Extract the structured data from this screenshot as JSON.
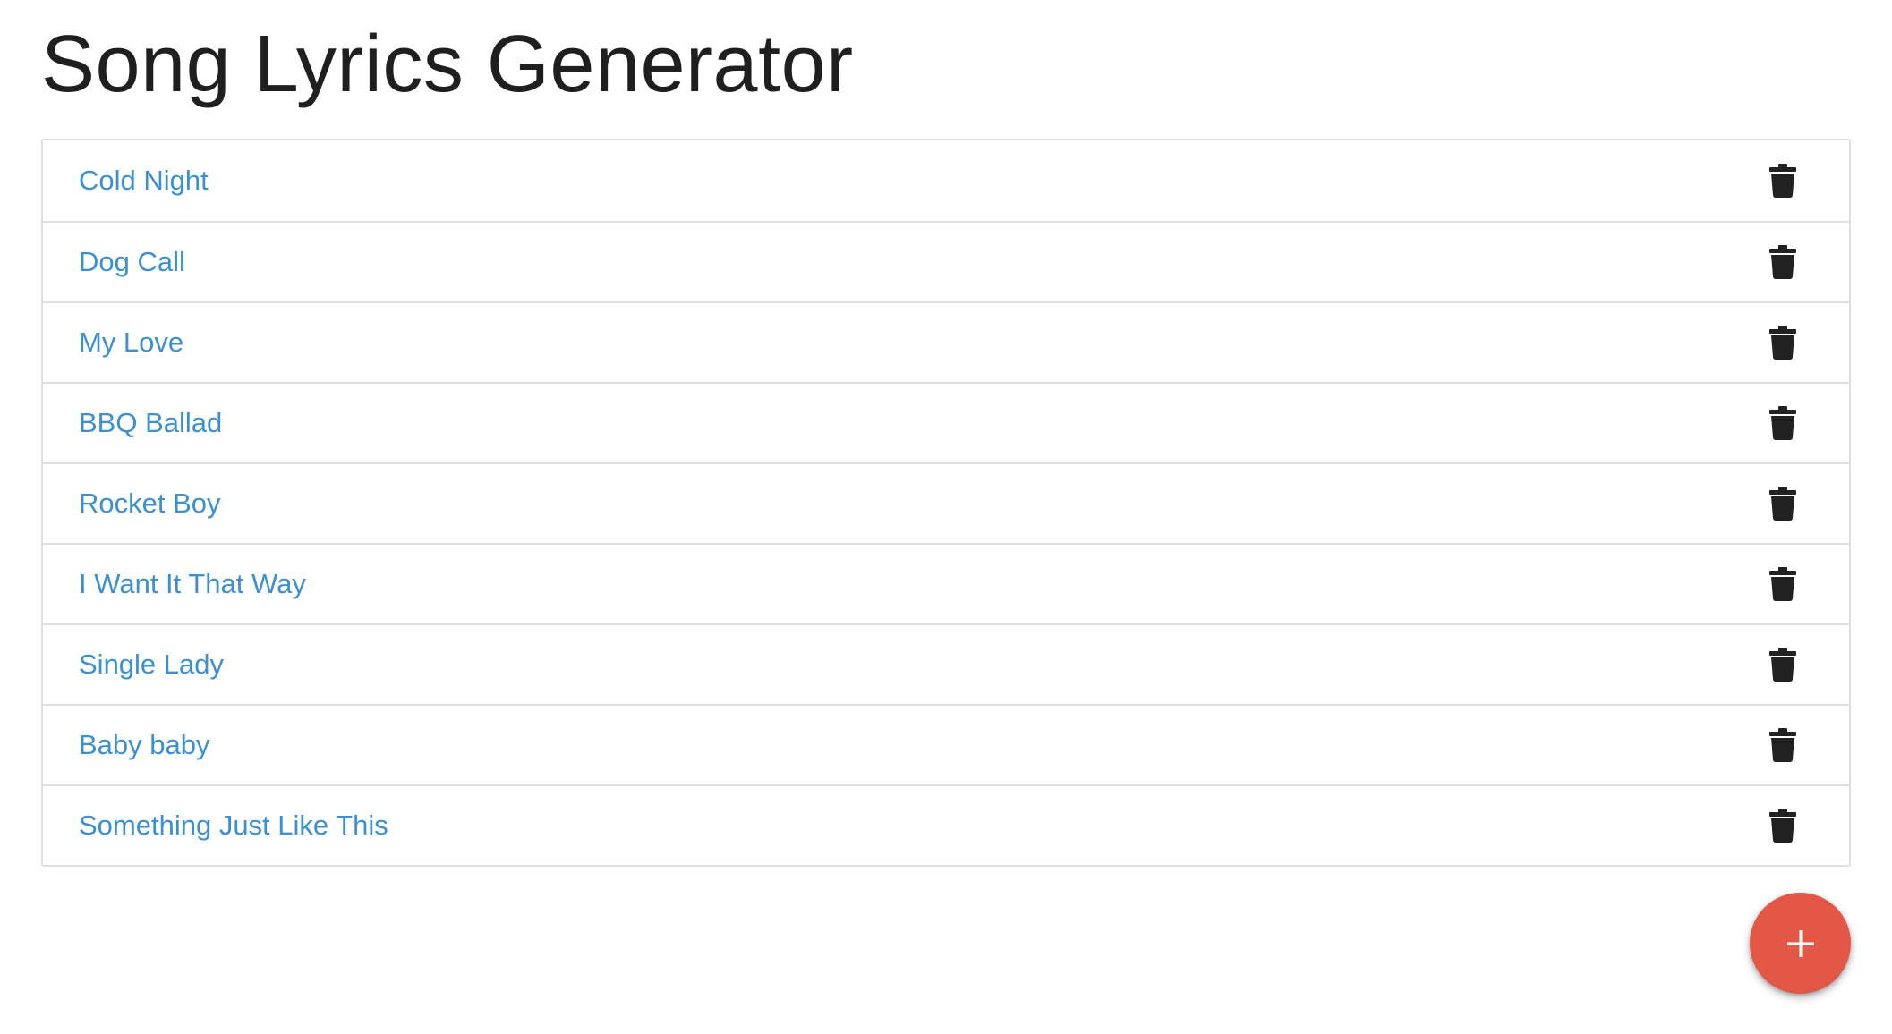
{
  "page": {
    "title": "Song Lyrics Generator"
  },
  "songs": [
    {
      "title": "Cold Night"
    },
    {
      "title": "Dog Call"
    },
    {
      "title": "My Love"
    },
    {
      "title": "BBQ Ballad"
    },
    {
      "title": "Rocket Boy"
    },
    {
      "title": "I Want It That Way"
    },
    {
      "title": "Single Lady"
    },
    {
      "title": "Baby baby"
    },
    {
      "title": "Something Just Like This"
    }
  ],
  "icons": {
    "delete": "trash-icon",
    "add": "plus-icon"
  },
  "colors": {
    "link": "#3b8fd4",
    "fab": "#e35747",
    "icon": "#212121",
    "border": "#e0e0e0"
  }
}
